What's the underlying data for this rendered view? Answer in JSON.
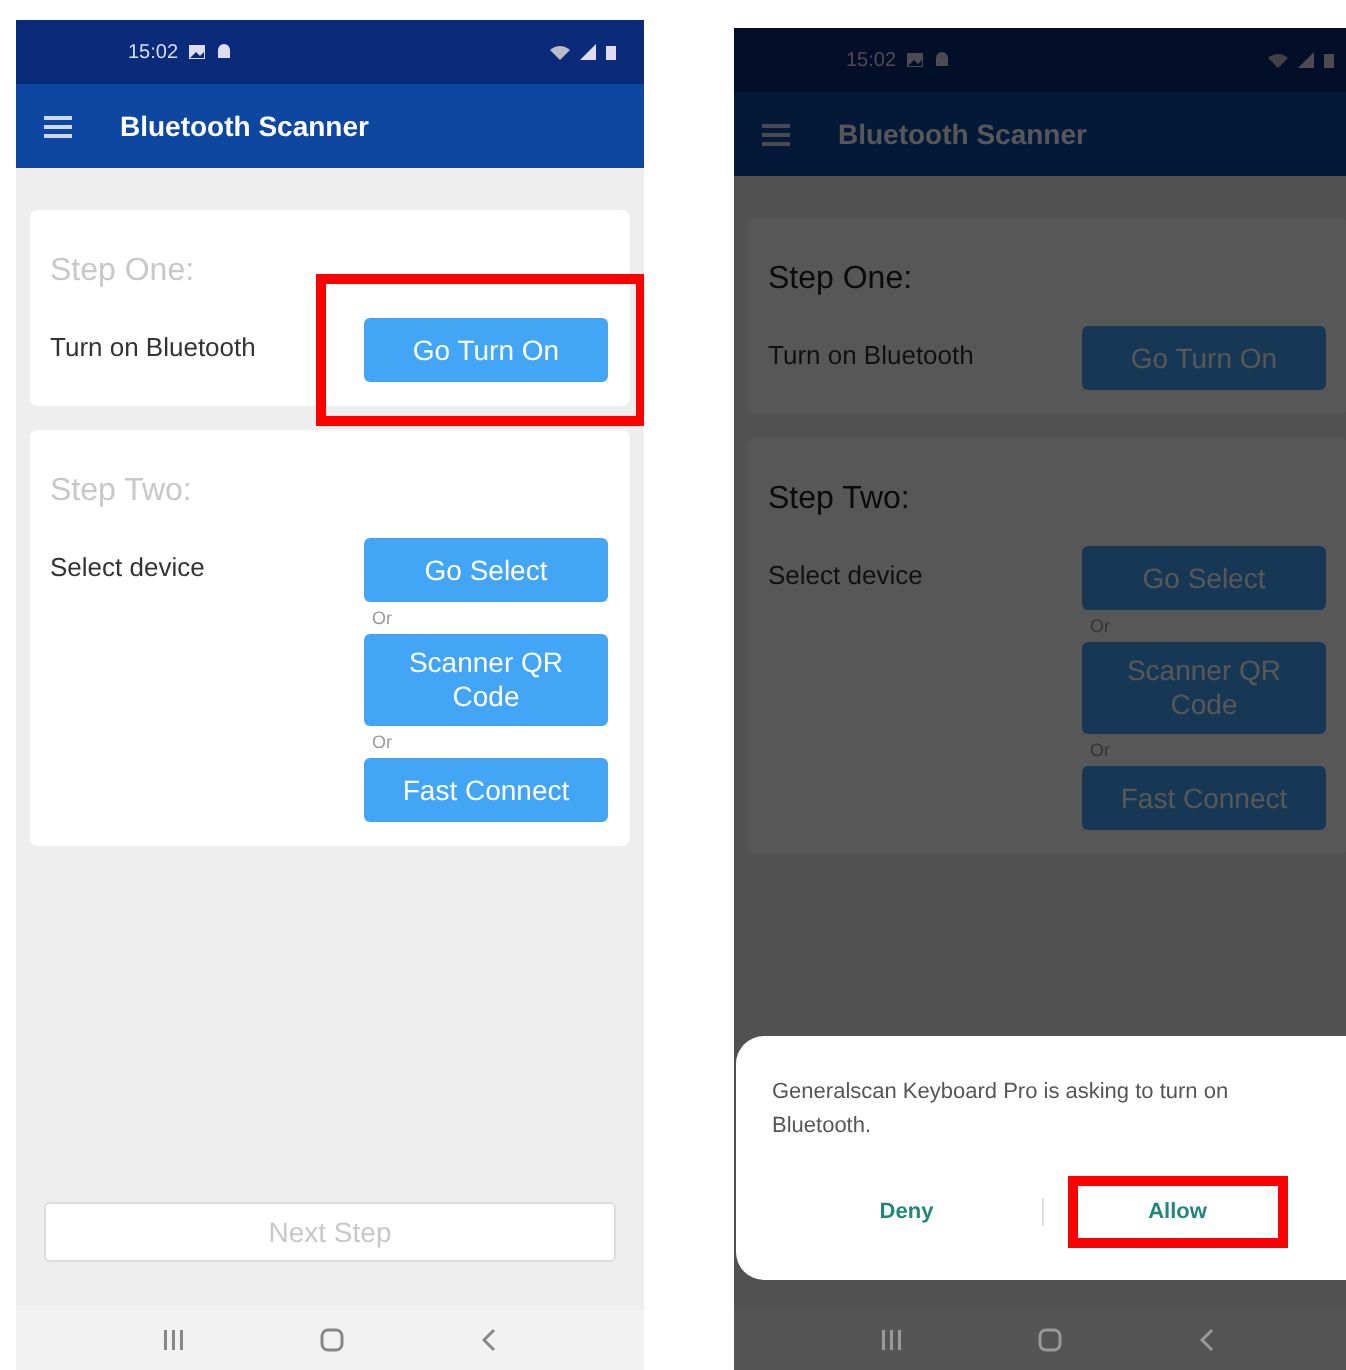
{
  "screens": [
    {
      "status_time": "15:02",
      "title": "Bluetooth Scanner",
      "dimmed": false,
      "steps": [
        {
          "title": "Step One:",
          "label": "Turn on Bluetooth",
          "actions": [
            {
              "kind": "button",
              "label": "Go Turn On",
              "highlighted": true
            }
          ]
        },
        {
          "title": "Step Two:",
          "label": "Select device",
          "actions": [
            {
              "kind": "button",
              "label": "Go Select",
              "highlighted": false
            },
            {
              "kind": "separator",
              "label": "Or"
            },
            {
              "kind": "button",
              "label": "Scanner QR Code",
              "highlighted": false
            },
            {
              "kind": "separator",
              "label": "Or"
            },
            {
              "kind": "button",
              "label": "Fast Connect",
              "highlighted": false
            }
          ]
        }
      ],
      "next_step": "Next Step"
    },
    {
      "status_time": "15:02",
      "title": "Bluetooth Scanner",
      "dimmed": true,
      "steps": [
        {
          "title": "Step One:",
          "label": "Turn on Bluetooth",
          "actions": [
            {
              "kind": "button",
              "label": "Go Turn On",
              "highlighted": false
            }
          ]
        },
        {
          "title": "Step Two:",
          "label": "Select device",
          "actions": [
            {
              "kind": "button",
              "label": "Go Select",
              "highlighted": false
            },
            {
              "kind": "separator",
              "label": "Or"
            },
            {
              "kind": "button",
              "label": "Scanner QR Code",
              "highlighted": false
            },
            {
              "kind": "separator",
              "label": "Or"
            },
            {
              "kind": "button",
              "label": "Fast Connect",
              "highlighted": false
            }
          ]
        }
      ],
      "dialog": {
        "message": "Generalscan Keyboard Pro is asking to turn on Bluetooth.",
        "buttons": [
          {
            "label": "Deny",
            "highlighted": false
          },
          {
            "label": "Allow",
            "highlighted": true
          }
        ]
      }
    }
  ]
}
